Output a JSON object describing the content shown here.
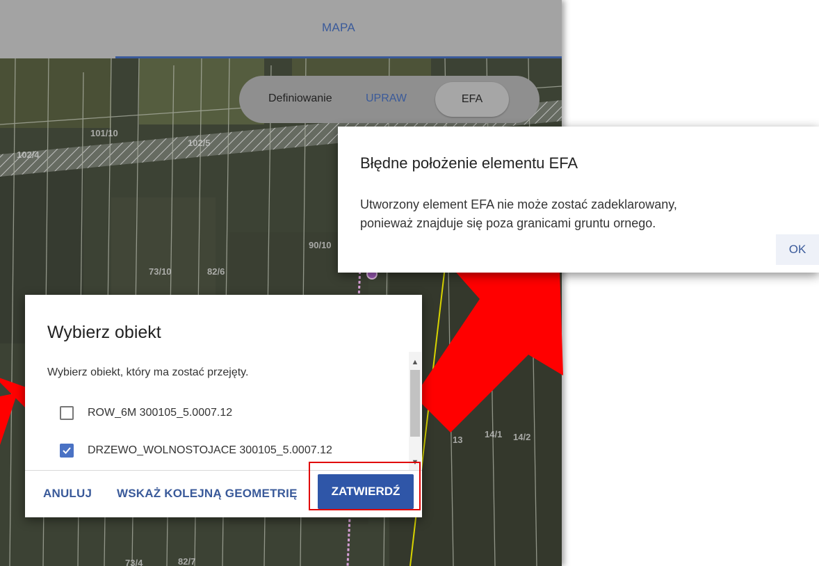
{
  "tabs": {
    "map_label": "MAPA"
  },
  "map": {
    "parcels": [
      {
        "id": "101/10"
      },
      {
        "id": "102/4"
      },
      {
        "id": "102/5"
      },
      {
        "id": "90/10"
      },
      {
        "id": "73/10"
      },
      {
        "id": "82/6"
      },
      {
        "id": "13"
      },
      {
        "id": "14/1"
      },
      {
        "id": "14/2"
      },
      {
        "id": "73/4"
      },
      {
        "id": "82/7"
      }
    ]
  },
  "mode_toggle": {
    "label": "Definiowanie",
    "option_crops": "UPRAW",
    "option_efa": "EFA",
    "selected": "EFA"
  },
  "error_dialog": {
    "title": "Błędne położenie elementu EFA",
    "message": "Utworzony element EFA nie może zostać zadeklarowany,\nponieważ znajduje się poza granicami gruntu ornego.",
    "ok_label": "OK"
  },
  "select_dialog": {
    "title": "Wybierz obiekt",
    "description": "Wybierz obiekt, który ma zostać przejęty.",
    "options": [
      {
        "label": "ROW_6M 300105_5.0007.12",
        "checked": false
      },
      {
        "label": "DRZEWO_WOLNOSTOJACE 300105_5.0007.12",
        "checked": true
      }
    ],
    "cancel_label": "ANULUJ",
    "next_geometry_label": "WSKAŻ KOLEJNĄ GEOMETRIĘ",
    "confirm_label": "ZATWIERDŹ"
  },
  "colors": {
    "accent": "#2f56a8",
    "annotation": "#ff0000",
    "highlight_border": "#e00000"
  },
  "icons": {
    "scroll_up": "chevron-up-icon",
    "scroll_down": "chevron-down-icon",
    "check": "check-icon",
    "annotation_arrow": "arrow-icon"
  }
}
